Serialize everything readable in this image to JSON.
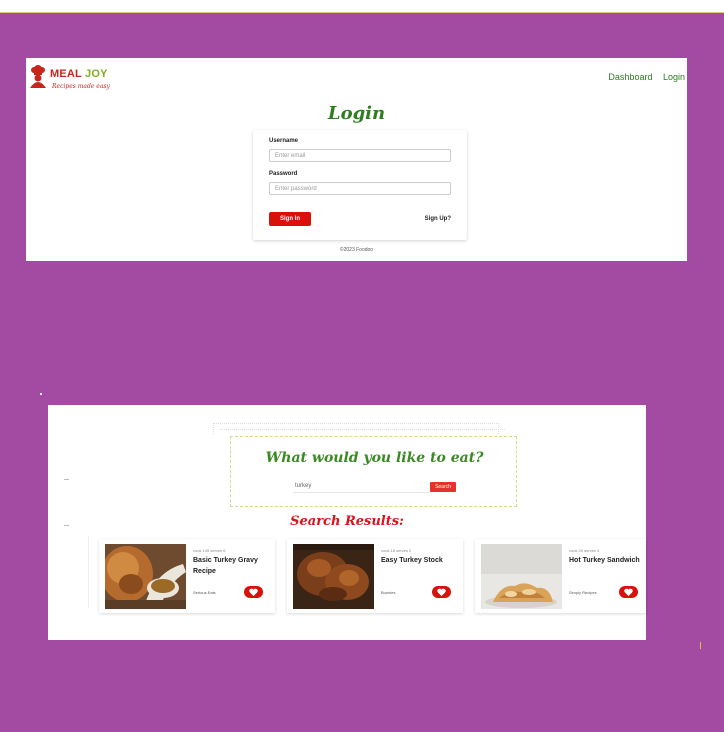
{
  "login_page": {
    "logo": {
      "name_part1": "MEAL",
      "name_part2": "JOY",
      "tagline": "Recipes made easy"
    },
    "nav": {
      "dashboard": "Dashboard",
      "login": "Login"
    },
    "title": "Login",
    "form": {
      "username_label": "Username",
      "username_placeholder": "Enter email",
      "password_label": "Password",
      "password_placeholder": "Enter password",
      "sign_in_label": "Sign In",
      "sign_up_label": "Sign Up?"
    },
    "footer": "©2023 Foodoo"
  },
  "search_page": {
    "heading": "What would you like to eat?",
    "search_value": "turkey",
    "search_button": "Search",
    "results_title": "Search Results:",
    "results": [
      {
        "meta": "cook 145 serves 6",
        "title": "Basic Turkey Gravy Recipe",
        "source": "Serious Eats",
        "image": "turkey-gravy-photo"
      },
      {
        "meta": "cook 18 serves 2",
        "title": "Easy Turkey Stock",
        "source": "Bunnies",
        "image": "turkey-stock-photo"
      },
      {
        "meta": "cook 20 serves 4",
        "title": "Hot Turkey Sandwich",
        "source": "Simply Recipes",
        "image": "turkey-sandwich-photo"
      }
    ]
  },
  "colors": {
    "background": "#a34aa2",
    "brand_green": "#2e7d1e",
    "brand_red": "#d8120b",
    "logo_red": "#c7261d",
    "logo_green": "#7fae1e"
  }
}
